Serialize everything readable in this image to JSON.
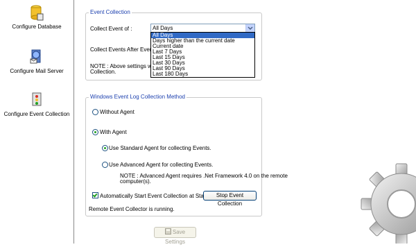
{
  "sidebar": {
    "items": [
      {
        "label": "Configure Database"
      },
      {
        "label": "Configure Mail Server"
      },
      {
        "label": "Configure Event Collection"
      }
    ]
  },
  "event_collection": {
    "legend": "Event Collection",
    "collect_event_of_label": "Collect Event of  :",
    "collect_event_selected": "All Days",
    "options": [
      "All Days",
      "Days higher than the current date",
      "Current date",
      "Last 7 Days",
      "Last 15 Days",
      "Last 30 Days",
      "Last 90 Days",
      "Last 180 Days"
    ],
    "after_every_label": "Collect Events After Every :",
    "note_line1": "NOTE : Above settings will be",
    "note_line2": "Collection."
  },
  "windows_log": {
    "legend": "Windows Event Log Collection Method",
    "without_agent": "Without Agent",
    "with_agent": "With Agent",
    "standard_agent": "Use Standard Agent for collecting Events.",
    "advanced_agent": "Use Advanced Agent for collecting Events.",
    "advanced_note_line1": "NOTE : Advanced Agent requires .Net Framework 4.0 on the remote",
    "advanced_note_line2": "computer(s).",
    "auto_start": "Automatically Start Event Collection at Startup",
    "stop_button": "Stop Event Collection",
    "status": "Remote Event Collector is running."
  },
  "save_button": "Save Settings",
  "colors": {
    "accent": "#1b3fae",
    "selection": "#316ac5",
    "check": "#21a121"
  }
}
